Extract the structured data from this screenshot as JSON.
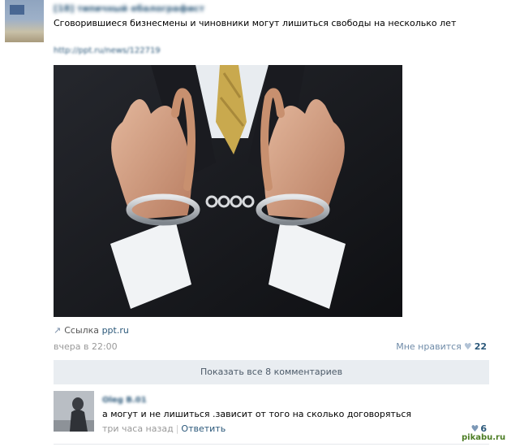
{
  "post": {
    "group_name": "[18] типичный ебалографист",
    "text": "Сговорившиеся бизнесмены и чиновники могут лишиться свободы на несколько лет",
    "url": "http://ppt.ru/news/122719",
    "link_label": "Ссылка",
    "link_domain": "ppt.ru",
    "time": "вчера в 22:00",
    "like_label": "Мне нравится",
    "like_count": "22"
  },
  "comments_bar": {
    "label": "Показать все 8 комментариев"
  },
  "comment": {
    "author": "Oleg B.01",
    "text": "а могут и не лишиться .зависит от того на сколько договоряться",
    "time": "три часа назад",
    "reply_label": "Ответить",
    "like_count": "6"
  },
  "watermark": "pikabu.ru",
  "icons": {
    "link": "link-icon",
    "heart": "heart-icon"
  }
}
